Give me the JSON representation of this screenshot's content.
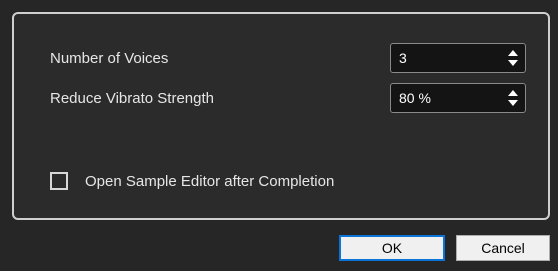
{
  "settings": {
    "voices": {
      "label": "Number of Voices",
      "value": "3"
    },
    "vibrato": {
      "label": "Reduce Vibrato Strength",
      "value": "80 %"
    },
    "open_editor": {
      "label": "Open Sample Editor after Completion",
      "checked": false
    }
  },
  "buttons": {
    "ok": "OK",
    "cancel": "Cancel"
  },
  "icons": {
    "spin_arrows": "up-down-arrows-icon"
  },
  "colors": {
    "background": "#262626",
    "panel_border": "#cfcfcf",
    "field_bg": "#141414",
    "ok_focus": "#0a74d9"
  }
}
